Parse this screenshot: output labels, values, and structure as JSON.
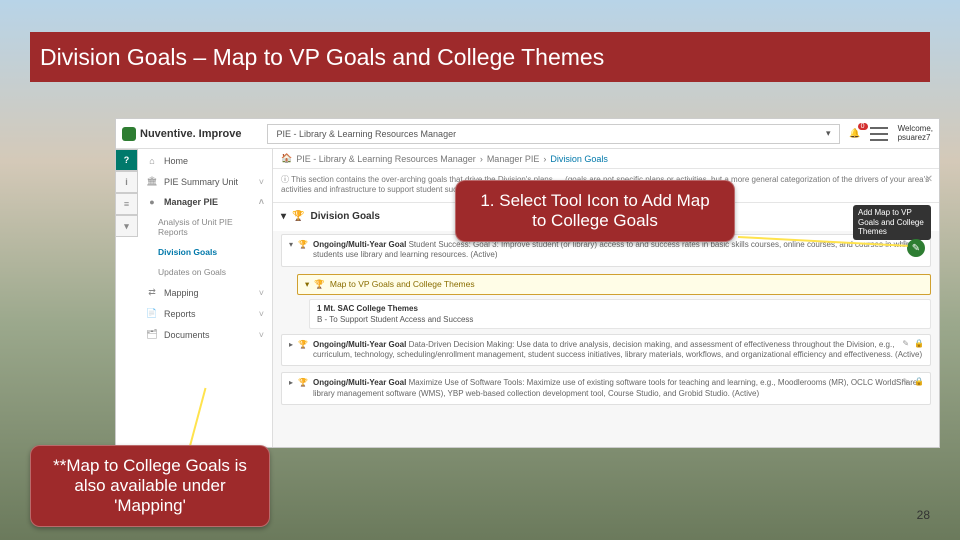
{
  "slide": {
    "title": "Division Goals – Map to VP Goals and College Themes",
    "page_number": "28"
  },
  "callouts": {
    "c1": "1. Select Tool Icon to Add Map to College Goals",
    "c2": "**Map to College Goals is also available under 'Mapping'"
  },
  "app": {
    "brand": "Nuventive. Improve",
    "context": "PIE - Library & Learning Resources Manager",
    "welcome_label": "Welcome,",
    "welcome_user": "psuarez7",
    "notifications": "0"
  },
  "breadcrumb": {
    "root_icon": "🏠",
    "seg1": "PIE - Library & Learning Resources Manager",
    "seg2": "Manager PIE",
    "seg3": "Division Goals"
  },
  "info_text": "This section contains the over-arching goals that drive the Division's plans … (goals are not specific plans or activities, but a more general categorization of the drivers of your area's activities and infrastructure to support student success. - Add new goals by clicking the green \"+\" symbol on the right.)",
  "sidebar": {
    "home": "Home",
    "summary": "PIE Summary Unit",
    "manager": "Manager PIE",
    "sub1": "Analysis of Unit PIE Reports",
    "sub2": "Division Goals",
    "sub3": "Updates on Goals",
    "mapping": "Mapping",
    "reports": "Reports",
    "documents": "Documents"
  },
  "section_header": "Division Goals",
  "goals": {
    "g1_title": "Ongoing/Multi-Year Goal",
    "g1_text": "Student Success: Goal 3: Improve student (or library) access to and success rates in basic skills courses, online courses, and courses in which students use library and learning resources. (Active)",
    "map_label": "Map to VP Goals and College Themes",
    "theme_header": "1 Mt. SAC College Themes",
    "theme_line": "B - To Support Student Access and Success",
    "g2_title": "Ongoing/Multi-Year Goal",
    "g2_text": "Data-Driven Decision Making: Use data to drive analysis, decision making, and assessment of effectiveness throughout the Division, e.g., curriculum, technology, scheduling/enrollment management, student success initiatives, library materials, workflows, and organizational efficiency and effectiveness. (Active)",
    "g3_title": "Ongoing/Multi-Year Goal",
    "g3_text": "Maximize Use of Software Tools: Maximize use of existing software tools for teaching and learning, e.g., Moodlerooms (MR), OCLC WorldShare library management software (WMS), YBP web-based collection development tool, Course Studio, and Grobid Studio. (Active)"
  },
  "tooltip": "Add Map to VP Goals and College Themes"
}
